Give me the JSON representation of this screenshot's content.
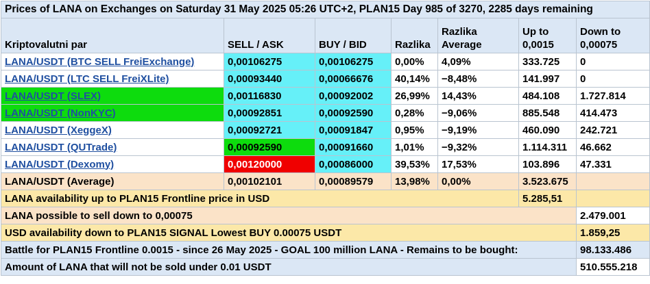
{
  "title": "Prices of LANA on Exchanges on Saturday 31 May 2025 05:26 UTC+2, PLAN15 Day 985 of 3270, 2285 days remaining",
  "headers": {
    "pair": "Kriptovalutni par",
    "sell": "SELL / ASK",
    "buy": "BUY / BID",
    "razlika": "Razlika",
    "razlika_avg_1": "Razlika",
    "razlika_avg_2": "Average",
    "up_1": "Up to",
    "up_2": "0,0015",
    "down_1": "Down to",
    "down_2": "0,00075"
  },
  "rows": [
    {
      "pair": "LANA/USDT (BTC SELL FreiExchange)",
      "sell": "0,00106275",
      "buy": "0,00106275",
      "razlika": "0,00%",
      "avg": "4,09%",
      "up": "333.725",
      "down": "0"
    },
    {
      "pair": "LANA/USDT (LTC SELL FreiXLite)",
      "sell": "0,00093440",
      "buy": "0,00066676",
      "razlika": "40,14%",
      "avg": "−8,48%",
      "up": "141.997",
      "down": "0"
    },
    {
      "pair": "LANA/USDT (SLEX)",
      "sell": "0,00116830",
      "buy": "0,00092002",
      "razlika": "26,99%",
      "avg": "14,43%",
      "up": "484.108",
      "down": "1.727.814"
    },
    {
      "pair": "LANA/USDT (NonKYC)",
      "sell": "0,00092851",
      "buy": "0,00092590",
      "razlika": "0,28%",
      "avg": "−9,06%",
      "up": "885.548",
      "down": "414.473"
    },
    {
      "pair": "LANA/USDT (XeggeX)",
      "sell": "0,00092721",
      "buy": "0,00091847",
      "razlika": "0,95%",
      "avg": "−9,19%",
      "up": "460.090",
      "down": "242.721"
    },
    {
      "pair": "LANA/USDT (QUTrade)",
      "sell": "0,00092590",
      "buy": "0,00091660",
      "razlika": "1,01%",
      "avg": "−9,32%",
      "up": "1.114.311",
      "down": "46.662"
    },
    {
      "pair": "LANA/USDT (Dexomy)",
      "sell": "0,00120000",
      "buy": "0,00086000",
      "razlika": "39,53%",
      "avg": "17,53%",
      "up": "103.896",
      "down": "47.331"
    }
  ],
  "average": {
    "pair": "LANA/USDT (Average)",
    "sell": "0,00102101",
    "buy": "0,00089579",
    "razlika": "13,98%",
    "avg": "0,00%",
    "up": "3.523.675",
    "down": ""
  },
  "summary": {
    "availability_label": "LANA availability up to PLAN15 Frontline price in USD",
    "availability_value": "5.285,51",
    "sell_down_label": "LANA possible to sell down to 0,00075",
    "sell_down_value": "2.479.001",
    "usd_down_label": "USD availability down to PLAN15 SIGNAL Lowest BUY 0.00075 USDT",
    "usd_down_value": "1.859,25",
    "battle_label": "Battle for PLAN15 Frontline 0.0015 - since 26 May 2025 - GOAL 100 million LANA - Remains to be bought:",
    "battle_value": "98.133.486",
    "not_sold_label": "Amount of LANA that will not be sold under 0.01 USDT",
    "not_sold_value": "510.555.218"
  },
  "colors": {
    "cyan": "#66f0f8",
    "green": "#0ddc0d",
    "red": "#f00000",
    "header_blue": "#dbe7f5",
    "peach": "#fbe3c8",
    "yellow": "#fce8a8",
    "link": "#1f4fa0"
  }
}
